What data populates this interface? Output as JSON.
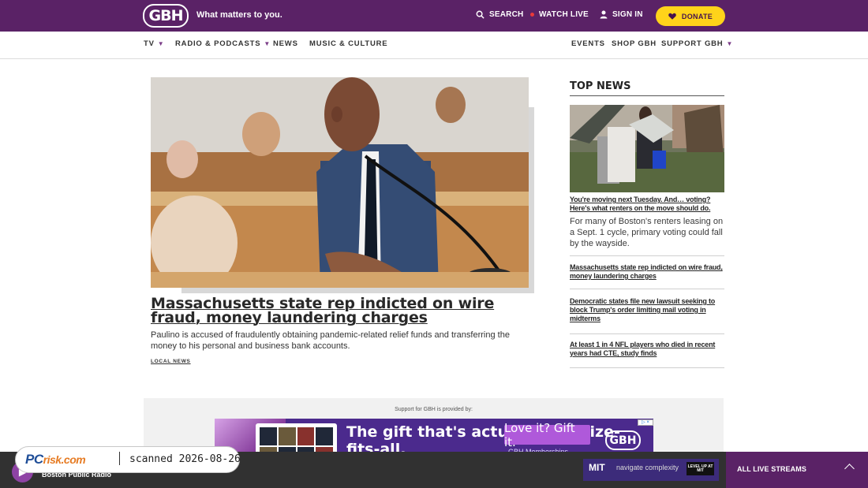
{
  "header": {
    "logo_text": "GBH",
    "tagline": "What matters to you.",
    "search_label": "SEARCH",
    "watch_label": "WATCH LIVE",
    "signin_label": "SIGN IN",
    "donate_label": "DONATE"
  },
  "nav": {
    "left": [
      "TV",
      "RADIO & PODCASTS",
      "NEWS",
      "MUSIC & CULTURE"
    ],
    "right": [
      "EVENTS",
      "SHOP GBH",
      "SUPPORT GBH"
    ]
  },
  "main_story": {
    "headline": "Massachusetts state rep indicted on wire fraud, money laundering charges",
    "summary": "Paulino is accused of fraudulently obtaining pandemic-related relief funds and transferring the money to his personal and business bank accounts.",
    "category": "LOCAL NEWS"
  },
  "top_news": {
    "title": "TOP NEWS",
    "featured_headline": "You're moving next Tuesday. And… voting? Here's what renters on the move should do.",
    "featured_summary": "For many of Boston's renters leasing on a Sept. 1 cycle, primary voting could fall by the wayside.",
    "items": [
      "Massachusetts state rep indicted on wire fraud, money laundering charges",
      "Democratic states file new lawsuit seeking to block Trump's order limiting mail voting in midterms",
      "At least 1 in 4 NFL players who died in recent years had CTE, study finds"
    ]
  },
  "support": {
    "note": "Support for GBH is provided by:"
  },
  "ad": {
    "headline": "The gift that's actually one-size-fits-all.",
    "button": "Love it? Gift it.",
    "logo": "GBH",
    "subtext": "GBH Memberships"
  },
  "player": {
    "station": "Boston Public Radio",
    "live_streams": "ALL LIVE STREAMS"
  },
  "scanner": {
    "logo_main": "PC",
    "logo_suffix": "risk.com",
    "scan_text": "scanned 2026-08-26"
  },
  "mini_ad": {
    "brand": "MIT",
    "tagline": "navigate complexity",
    "cta": "LEVEL UP AT MIT"
  },
  "colors": {
    "header": "#5a2266",
    "donate": "#ffd31a",
    "accent": "#8e43a4"
  }
}
